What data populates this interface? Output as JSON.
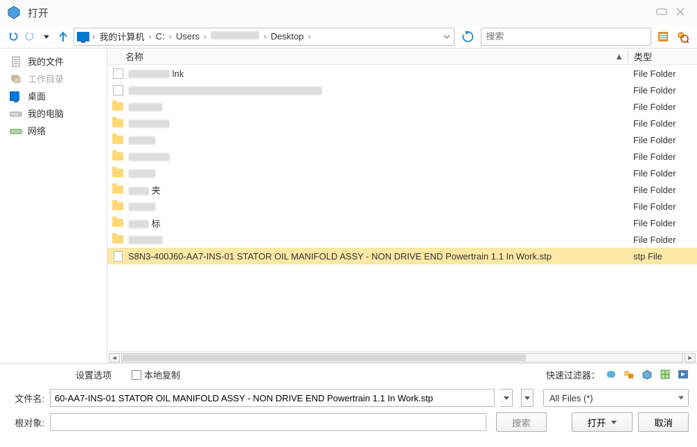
{
  "window": {
    "title": "打开"
  },
  "toolbar": {
    "search_placeholder": "搜索"
  },
  "breadcrumb": [
    "我的计算机",
    "C:",
    "Users",
    "",
    "Desktop"
  ],
  "sidebar": {
    "items": [
      {
        "label": "我的文件",
        "icon": "document-icon",
        "disabled": false
      },
      {
        "label": "工作目录",
        "icon": "stack-icon",
        "disabled": true
      },
      {
        "label": "桌面",
        "icon": "monitor-icon",
        "disabled": false
      },
      {
        "label": "我的电脑",
        "icon": "drive-icon",
        "disabled": false
      },
      {
        "label": "网络",
        "icon": "network-icon",
        "disabled": false
      }
    ]
  },
  "columns": {
    "name": "名称",
    "type": "类型"
  },
  "files": [
    {
      "name_hidden": true,
      "name_suffix": "lnk",
      "type": "File Folder",
      "icon": "link",
      "selected": false
    },
    {
      "name_hidden": true,
      "name_suffix": "",
      "type": "File Folder",
      "icon": "link",
      "selected": false
    },
    {
      "name_hidden": true,
      "name_suffix": "",
      "type": "File Folder",
      "icon": "folder",
      "selected": false
    },
    {
      "name_hidden": true,
      "name_suffix": "",
      "type": "File Folder",
      "icon": "folder",
      "selected": false
    },
    {
      "name_hidden": true,
      "name_suffix": "",
      "type": "File Folder",
      "icon": "folder",
      "selected": false
    },
    {
      "name_hidden": true,
      "name_suffix": "",
      "type": "File Folder",
      "icon": "folder",
      "selected": false
    },
    {
      "name_hidden": true,
      "name_suffix": "",
      "type": "File Folder",
      "icon": "folder",
      "selected": false
    },
    {
      "name_hidden": true,
      "name_suffix": "夹",
      "type": "File Folder",
      "icon": "folder",
      "selected": false
    },
    {
      "name_hidden": true,
      "name_suffix": "",
      "type": "File Folder",
      "icon": "folder",
      "selected": false
    },
    {
      "name_hidden": true,
      "name_suffix": "标",
      "type": "File Folder",
      "icon": "folder",
      "selected": false
    },
    {
      "name_hidden": true,
      "name_suffix": "",
      "type": "File Folder",
      "icon": "folder",
      "selected": false
    },
    {
      "name": "S8N3-400J60-AA7-INS-01 STATOR OIL MANIFOLD ASSY - NON DRIVE END Powertrain 1.1 In Work.stp",
      "type": "stp File",
      "icon": "file",
      "selected": true
    }
  ],
  "options": {
    "settings": "设置选项",
    "local_copy": "本地复制",
    "quick_filter_label": "快速过滤器："
  },
  "bottom": {
    "filename_label": "文件名:",
    "filename_value": "60-AA7-INS-01 STATOR OIL MANIFOLD ASSY - NON DRIVE END Powertrain 1.1 In Work.stp",
    "filter_value": "All Files (*)",
    "root_label": "根对象:",
    "root_value": "",
    "search_btn": "搜索",
    "open_btn": "打开",
    "cancel_btn": "取消"
  }
}
